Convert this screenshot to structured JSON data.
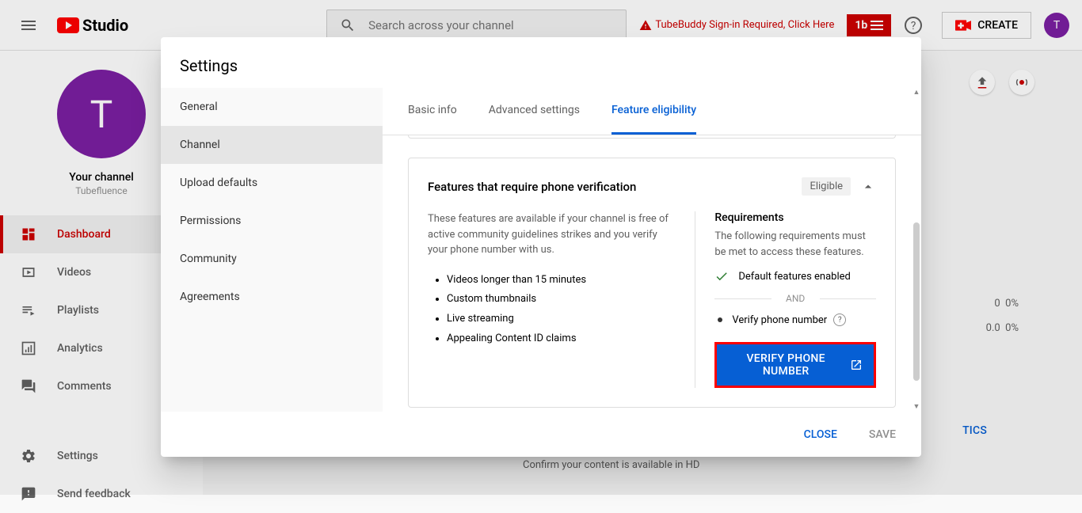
{
  "header": {
    "logo_text": "Studio",
    "search_placeholder": "Search across your channel",
    "tubebuddy_warning": "TubeBuddy Sign-in Required, Click Here",
    "tb_badge": "1b",
    "create_label": "CREATE",
    "avatar_letter": "T"
  },
  "sidebar": {
    "your_channel_label": "Your channel",
    "channel_name": "Tubefluence",
    "avatar_letter": "T",
    "items": [
      {
        "label": "Dashboard"
      },
      {
        "label": "Videos"
      },
      {
        "label": "Playlists"
      },
      {
        "label": "Analytics"
      },
      {
        "label": "Comments"
      },
      {
        "label": "Settings"
      },
      {
        "label": "Send feedback"
      }
    ]
  },
  "background": {
    "stat1_val": "0",
    "stat1_pct": "0%",
    "stat2_val": "0.0",
    "stat2_pct": "0%",
    "analytics_link": "TICS",
    "confirm_text": "Confirm your content is available in HD"
  },
  "modal": {
    "title": "Settings",
    "nav": [
      {
        "label": "General"
      },
      {
        "label": "Channel"
      },
      {
        "label": "Upload defaults"
      },
      {
        "label": "Permissions"
      },
      {
        "label": "Community"
      },
      {
        "label": "Agreements"
      }
    ],
    "tabs": [
      {
        "label": "Basic info"
      },
      {
        "label": "Advanced settings"
      },
      {
        "label": "Feature eligibility"
      }
    ],
    "card": {
      "title": "Features that require phone verification",
      "eligible": "Eligible",
      "description": "These features are available if your channel is free of active community guidelines strikes and you verify your phone number with us.",
      "features": [
        "Videos longer than 15 minutes",
        "Custom thumbnails",
        "Live streaming",
        "Appealing Content ID claims"
      ],
      "requirements_title": "Requirements",
      "requirements_desc": "The following requirements must be met to access these features.",
      "req_enabled": "Default features enabled",
      "and_label": "AND",
      "req_verify": "Verify phone number",
      "verify_button": "VERIFY PHONE NUMBER"
    },
    "footer": {
      "close": "CLOSE",
      "save": "SAVE"
    }
  }
}
